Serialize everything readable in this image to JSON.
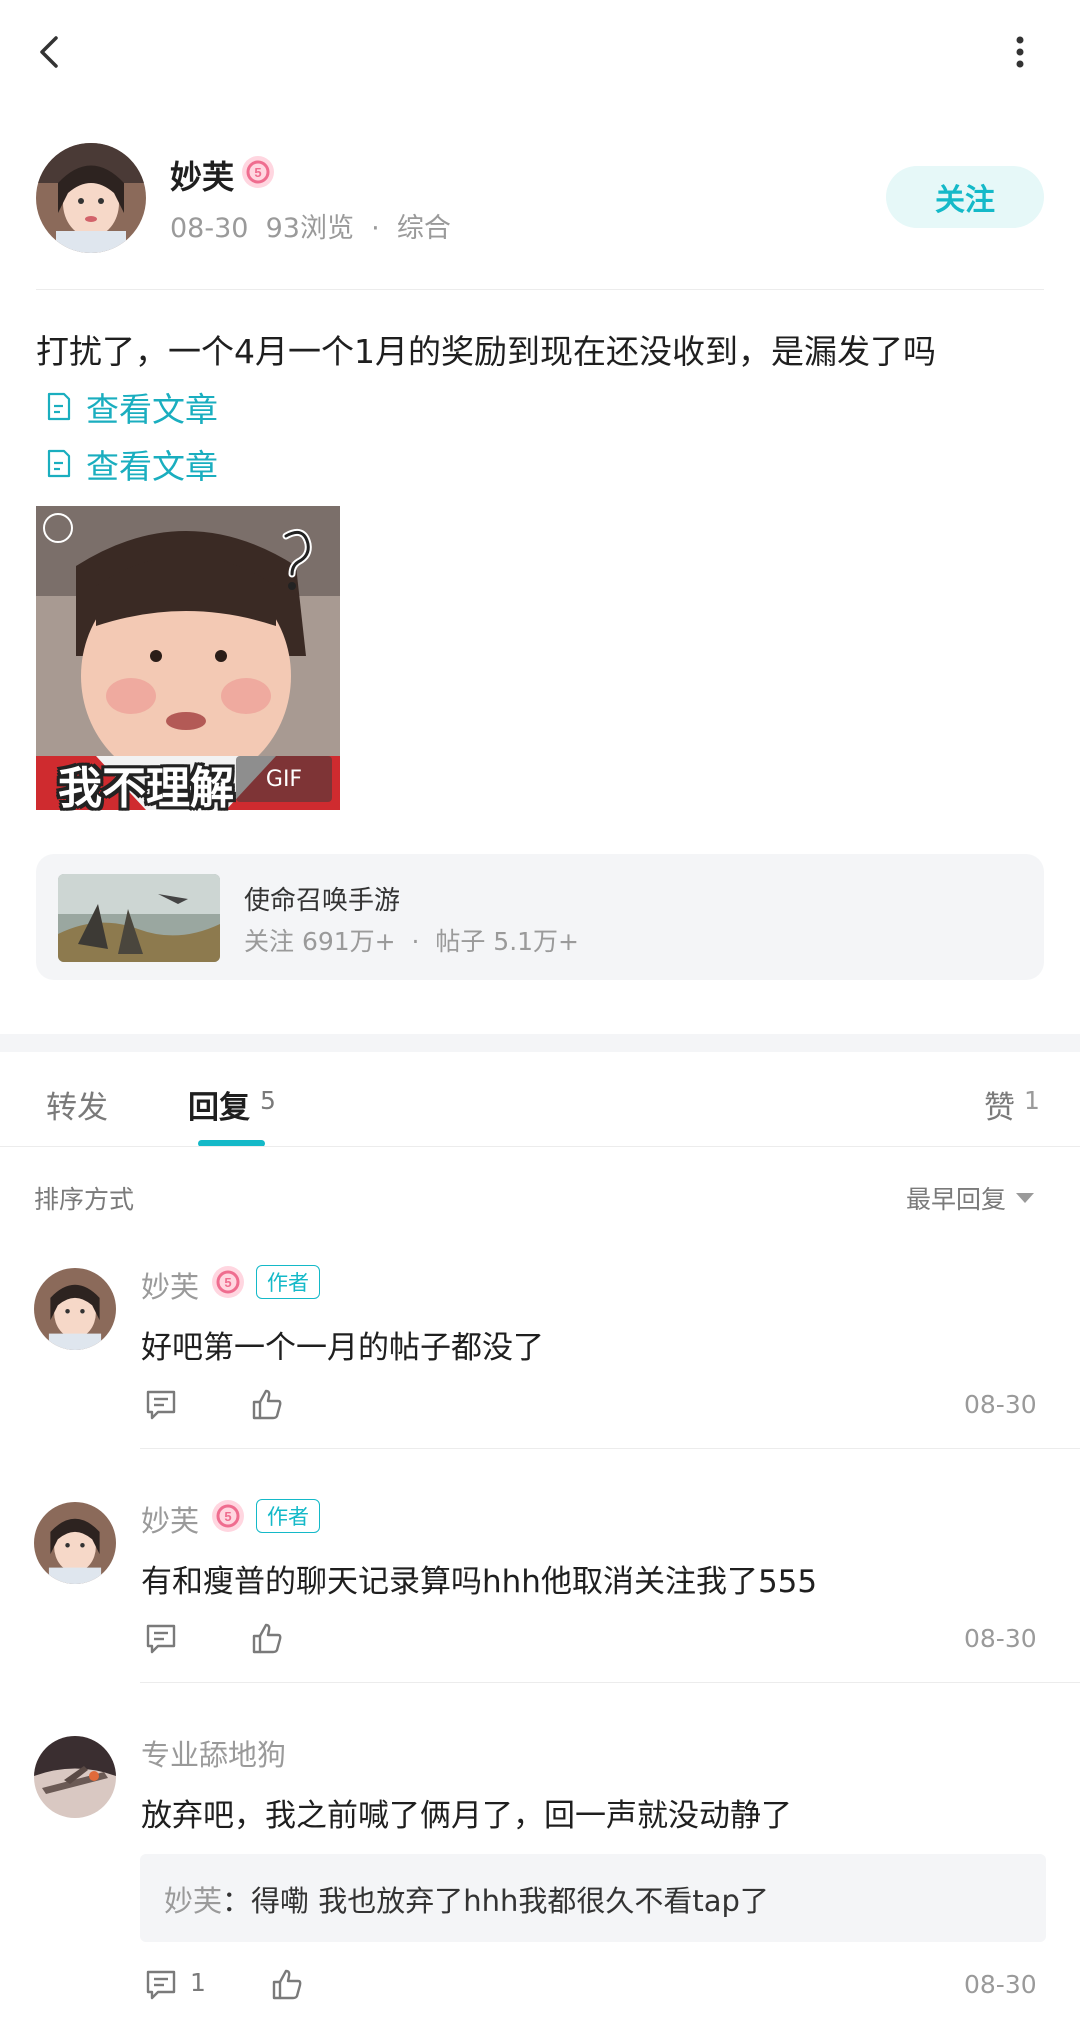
{
  "post": {
    "author": {
      "name": "妙芙",
      "meta": "08-30  93浏览  ·  综合",
      "follow_label": "关注"
    },
    "text": "打扰了，一个4月一个1月的奖励到现在还没收到，是漏发了吗",
    "article_links": [
      {
        "label": "查看文章"
      },
      {
        "label": "查看文章"
      }
    ],
    "gif": {
      "badge": "GIF",
      "caption": "我不理解"
    }
  },
  "forum": {
    "name": "使命召唤手游",
    "stats": "关注 691万+  ·  帖子 5.1万+"
  },
  "tabs": {
    "forward": "转发",
    "reply": "回复",
    "reply_count": "5",
    "like": "赞",
    "like_count": "1"
  },
  "sort": {
    "label": "排序方式",
    "value": "最早回复"
  },
  "comments": [
    {
      "name": "妙芙",
      "tag": "作者",
      "text": "好吧第一个一月的帖子都没了",
      "date": "08-30"
    },
    {
      "name": "妙芙",
      "tag": "作者",
      "text": "有和瘦普的聊天记录算吗hhh他取消关注我了555",
      "date": "08-30"
    },
    {
      "name": "专业舔地狗",
      "text": "放弃吧，我之前喊了俩月了，回一声就没动静了",
      "quote_name": "妙芙",
      "quote_text": "：得嘞 我也放弃了hhh我都很久不看tap了",
      "reply_count": "1",
      "date": "08-30"
    }
  ],
  "colors": {
    "accent": "#14b9c8",
    "follow_bg": "#e6f8f8",
    "card_bg": "#f4f5f7",
    "muted_text": "#9a9a9a"
  },
  "icons": [
    "back-arrow-icon",
    "more-vertical-icon",
    "level-badge-icon",
    "article-doc-icon",
    "comment-icon",
    "thumbs-up-icon",
    "sort-caret-icon"
  ]
}
